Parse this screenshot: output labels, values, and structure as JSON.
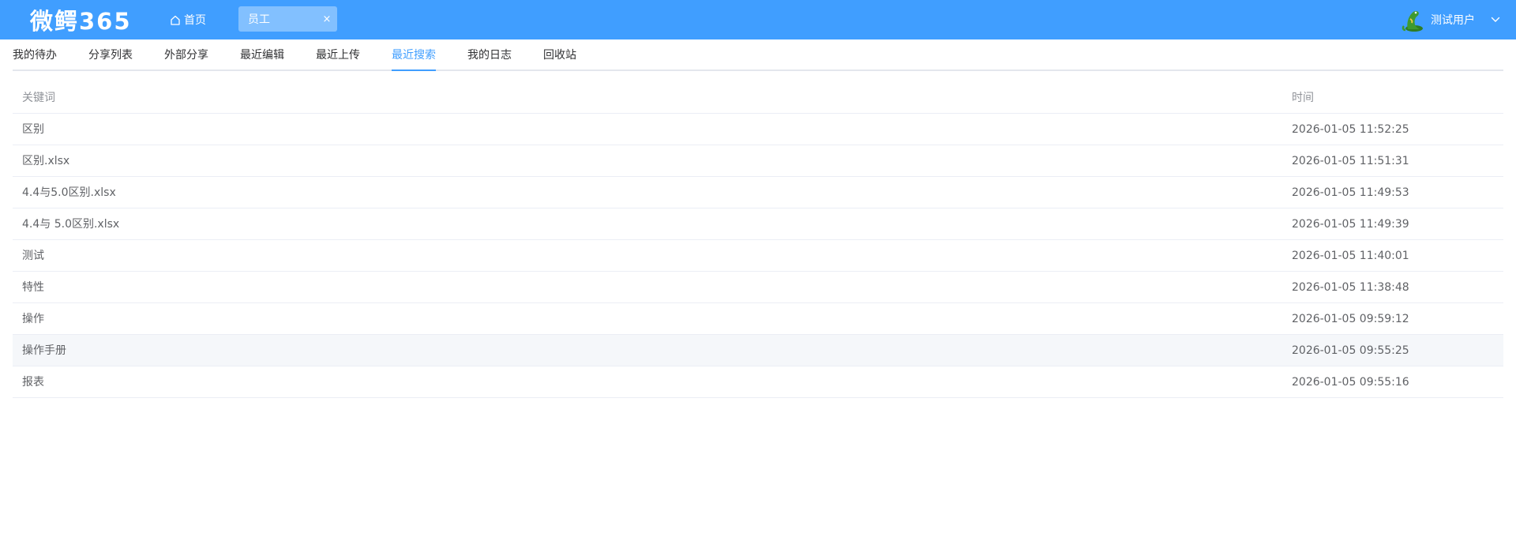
{
  "header": {
    "logo_text": "微鳄365",
    "home_label": "首页",
    "open_tab_label": "员工",
    "close_glyph": "×",
    "user_name": "测试用户",
    "colors": {
      "primary": "#409eff",
      "avatar_green": "#3f9a2f"
    }
  },
  "subnav": {
    "tabs": [
      {
        "label": "我的待办"
      },
      {
        "label": "分享列表"
      },
      {
        "label": "外部分享"
      },
      {
        "label": "最近编辑"
      },
      {
        "label": "最近上传"
      },
      {
        "label": "最近搜索"
      },
      {
        "label": "我的日志"
      },
      {
        "label": "回收站"
      }
    ],
    "active_index": 5
  },
  "table": {
    "columns": {
      "keyword": "关键词",
      "time": "时间"
    },
    "rows": [
      {
        "keyword": "区别",
        "time": "2026-01-05 11:52:25"
      },
      {
        "keyword": "区别.xlsx",
        "time": "2026-01-05 11:51:31"
      },
      {
        "keyword": "4.4与5.0区别.xlsx",
        "time": "2026-01-05 11:49:53"
      },
      {
        "keyword": "4.4与 5.0区别.xlsx",
        "time": "2026-01-05 11:49:39"
      },
      {
        "keyword": "测试",
        "time": "2026-01-05 11:40:01"
      },
      {
        "keyword": "特性",
        "time": "2026-01-05 11:38:48"
      },
      {
        "keyword": "操作",
        "time": "2026-01-05 09:59:12"
      },
      {
        "keyword": "操作手册",
        "time": "2026-01-05 09:55:25"
      },
      {
        "keyword": "报表",
        "time": "2026-01-05 09:55:16"
      }
    ]
  }
}
